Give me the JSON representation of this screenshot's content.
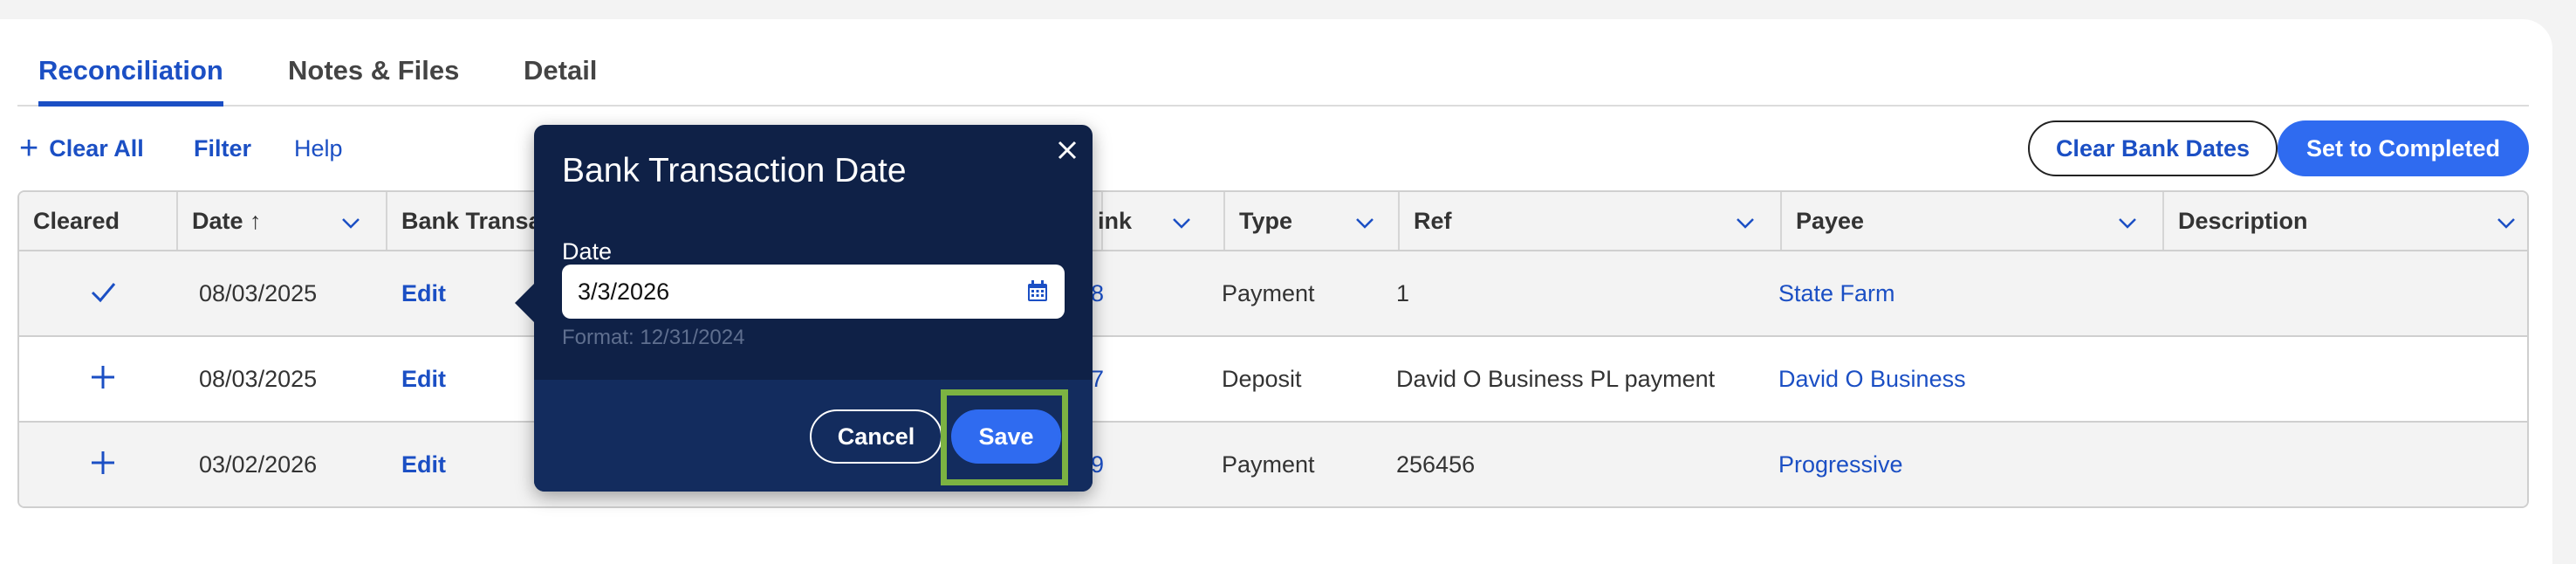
{
  "tabs": [
    {
      "label": "Reconciliation",
      "active": true
    },
    {
      "label": "Notes & Files",
      "active": false
    },
    {
      "label": "Detail",
      "active": false
    }
  ],
  "toolbar": {
    "clear_all": "Clear All",
    "filter": "Filter",
    "help": "Help",
    "clear_bank_dates": "Clear Bank Dates",
    "set_to_completed": "Set to Completed"
  },
  "table": {
    "columns": [
      {
        "label": "Cleared"
      },
      {
        "label": "Date ↑"
      },
      {
        "label": "Bank Transa"
      },
      {
        "label": "ink"
      },
      {
        "label": "Type"
      },
      {
        "label": "Ref"
      },
      {
        "label": "Payee"
      },
      {
        "label": "Description"
      }
    ],
    "rows": [
      {
        "cleared_icon": "check-icon",
        "date": "08/03/2025",
        "bank": "Edit",
        "link": "8",
        "type": "Payment",
        "ref": "1",
        "payee": "State Farm",
        "description": ""
      },
      {
        "cleared_icon": "plus-icon",
        "date": "08/03/2025",
        "bank": "Edit",
        "link": "7",
        "type": "Deposit",
        "ref": "David O Business PL payment",
        "payee": "David O Business",
        "description": ""
      },
      {
        "cleared_icon": "plus-icon",
        "date": "03/02/2026",
        "bank": "Edit",
        "link": "9",
        "type": "Payment",
        "ref": "256456",
        "payee": "Progressive",
        "description": ""
      }
    ]
  },
  "popover": {
    "title": "Bank Transaction Date",
    "field_label": "Date",
    "value": "3/3/2026",
    "hint": "Format: 12/31/2024",
    "cancel": "Cancel",
    "save": "Save"
  },
  "colors": {
    "accent": "#1b4fc4",
    "primary_button": "#2f6bf0",
    "popover_bg": "#0f2147",
    "highlight": "#7cb342"
  }
}
